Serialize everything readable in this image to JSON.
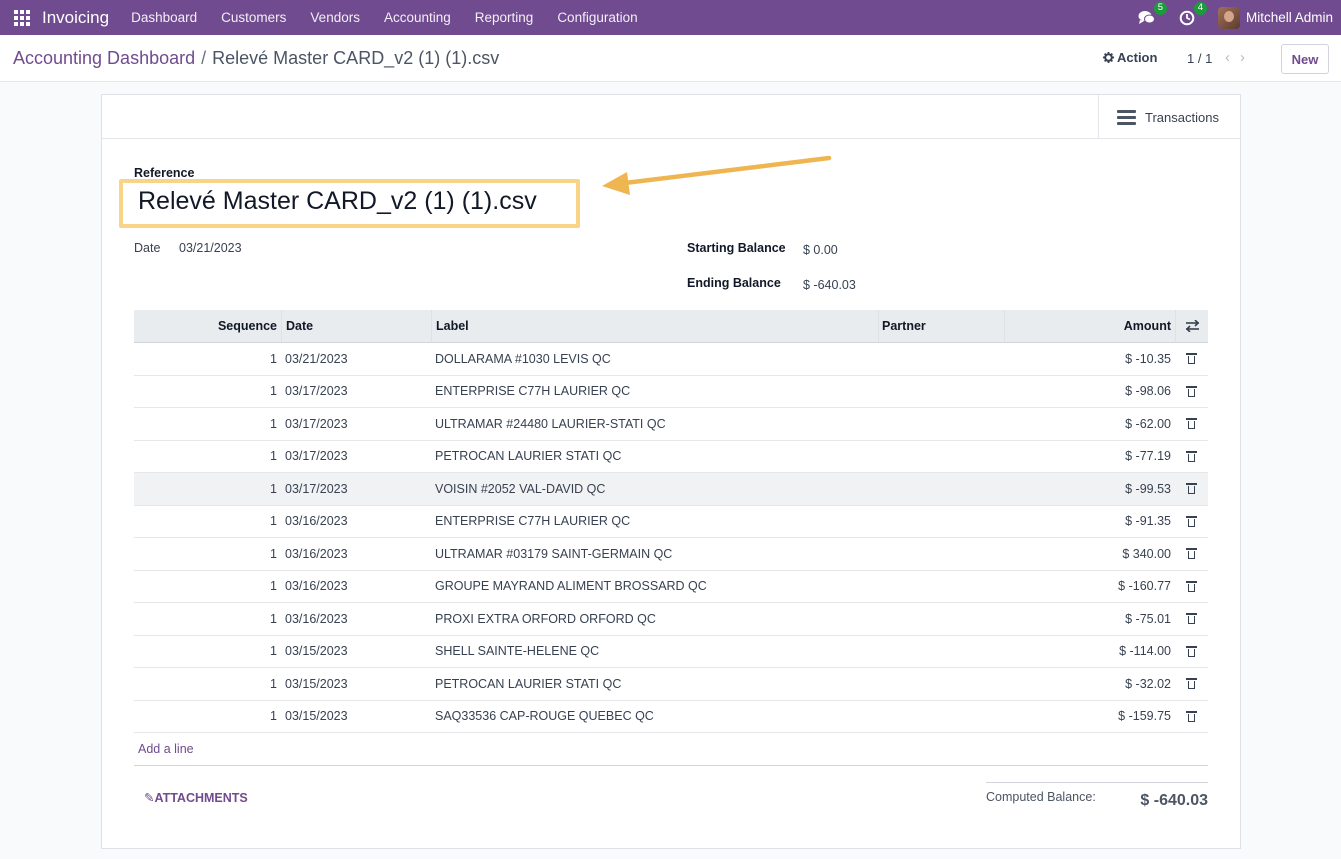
{
  "navbar": {
    "app_name": "Invoicing",
    "menu": [
      "Dashboard",
      "Customers",
      "Vendors",
      "Accounting",
      "Reporting",
      "Configuration"
    ],
    "messages_count": "5",
    "activities_count": "4",
    "user_name": "Mitchell Admin",
    "bg_color": "#714b8f"
  },
  "control": {
    "breadcrumb_parent": "Accounting Dashboard",
    "breadcrumb_current": "Relevé Master CARD_v2 (1) (1).csv",
    "action_label": "Action",
    "pager": "1 / 1",
    "new_label": "New"
  },
  "form": {
    "transactions_button": "Transactions",
    "reference_label": "Reference",
    "reference_value": "Relevé Master CARD_v2 (1) (1).csv",
    "date_label": "Date",
    "date_value": "03/21/2023",
    "starting_balance_label": "Starting Balance",
    "starting_balance_value": "$ 0.00",
    "ending_balance_label": "Ending Balance",
    "ending_balance_value": "$ -640.03"
  },
  "table": {
    "headers": {
      "sequence": "Sequence",
      "date": "Date",
      "label": "Label",
      "partner": "Partner",
      "amount": "Amount"
    },
    "rows": [
      {
        "seq": "1",
        "date": "03/21/2023",
        "label": "DOLLARAMA #1030 LEVIS QC",
        "partner": "",
        "amount": "$ -10.35"
      },
      {
        "seq": "1",
        "date": "03/17/2023",
        "label": "ENTERPRISE C77H LAURIER QC",
        "partner": "",
        "amount": "$ -98.06"
      },
      {
        "seq": "1",
        "date": "03/17/2023",
        "label": "ULTRAMAR #24480 LAURIER-STATI QC",
        "partner": "",
        "amount": "$ -62.00"
      },
      {
        "seq": "1",
        "date": "03/17/2023",
        "label": "PETROCAN LAURIER STATI QC",
        "partner": "",
        "amount": "$ -77.19"
      },
      {
        "seq": "1",
        "date": "03/17/2023",
        "label": "VOISIN #2052 VAL-DAVID QC",
        "partner": "",
        "amount": "$ -99.53"
      },
      {
        "seq": "1",
        "date": "03/16/2023",
        "label": "ENTERPRISE C77H LAURIER QC",
        "partner": "",
        "amount": "$ -91.35"
      },
      {
        "seq": "1",
        "date": "03/16/2023",
        "label": "ULTRAMAR #03179 SAINT-GERMAIN QC",
        "partner": "",
        "amount": "$ 340.00"
      },
      {
        "seq": "1",
        "date": "03/16/2023",
        "label": "GROUPE MAYRAND ALIMENT BROSSARD QC",
        "partner": "",
        "amount": "$ -160.77"
      },
      {
        "seq": "1",
        "date": "03/16/2023",
        "label": "PROXI EXTRA ORFORD ORFORD QC",
        "partner": "",
        "amount": "$ -75.01"
      },
      {
        "seq": "1",
        "date": "03/15/2023",
        "label": "SHELL SAINTE-HELENE QC",
        "partner": "",
        "amount": "$ -114.00"
      },
      {
        "seq": "1",
        "date": "03/15/2023",
        "label": "PETROCAN LAURIER STATI QC",
        "partner": "",
        "amount": "$ -32.02"
      },
      {
        "seq": "1",
        "date": "03/15/2023",
        "label": "SAQ33536 CAP-ROUGE QUEBEC QC",
        "partner": "",
        "amount": "$ -159.75"
      }
    ],
    "add_line": "Add a line"
  },
  "footer": {
    "attachments": "ATTACHMENTS",
    "computed_balance_label": "Computed Balance:",
    "computed_balance_value": "$ -640.03"
  }
}
